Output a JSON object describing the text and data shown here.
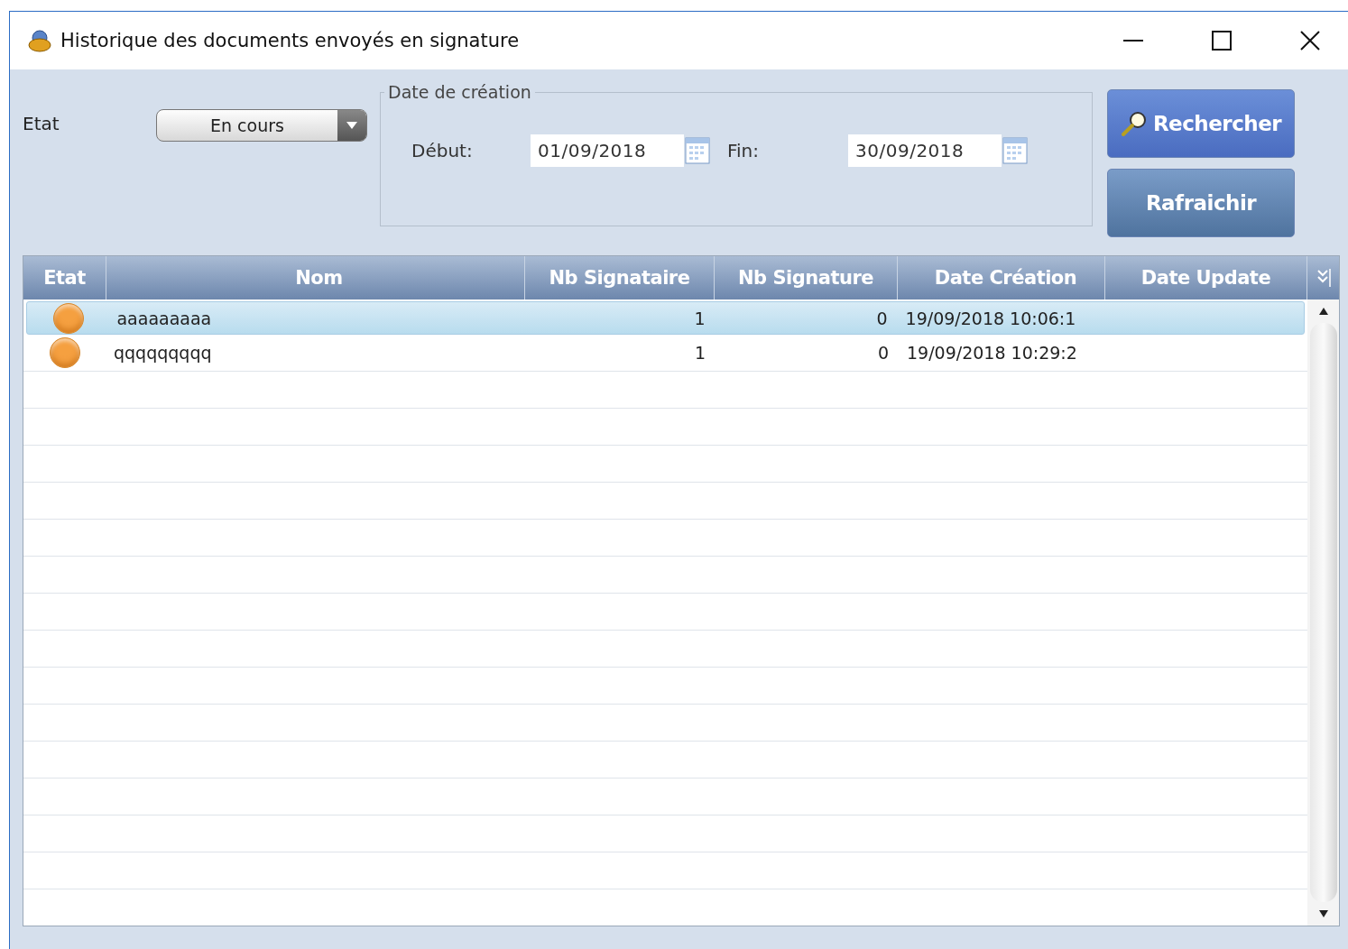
{
  "window": {
    "title": "Historique des documents envoyés en signature"
  },
  "filters": {
    "etat_label": "Etat",
    "etat_value": "En cours",
    "group_title": "Date de création",
    "debut_label": "Début:",
    "debut_value": "01/09/2018",
    "fin_label": "Fin:",
    "fin_value": "30/09/2018"
  },
  "buttons": [
    {
      "label": "Rechercher",
      "kind": "search"
    },
    {
      "label": "Rafraichir",
      "kind": "plain"
    }
  ],
  "table": {
    "columns": [
      "Etat",
      "Nom",
      "Nb Signataire",
      "Nb Signature",
      "Date Création",
      "Date Update"
    ],
    "rows": [
      {
        "selected": true,
        "color": "#f5a040",
        "nom": "aaaaaaaaa",
        "nb_signataire": "1",
        "nb_signature": "0",
        "date_creation": "19/09/2018 10:06:1"
      },
      {
        "selected": false,
        "color": "#f5a040",
        "nom": "qqqqqqqqq",
        "nb_signataire": "1",
        "nb_signature": "0",
        "date_creation": "19/09/2018 10:29:2"
      }
    ]
  }
}
